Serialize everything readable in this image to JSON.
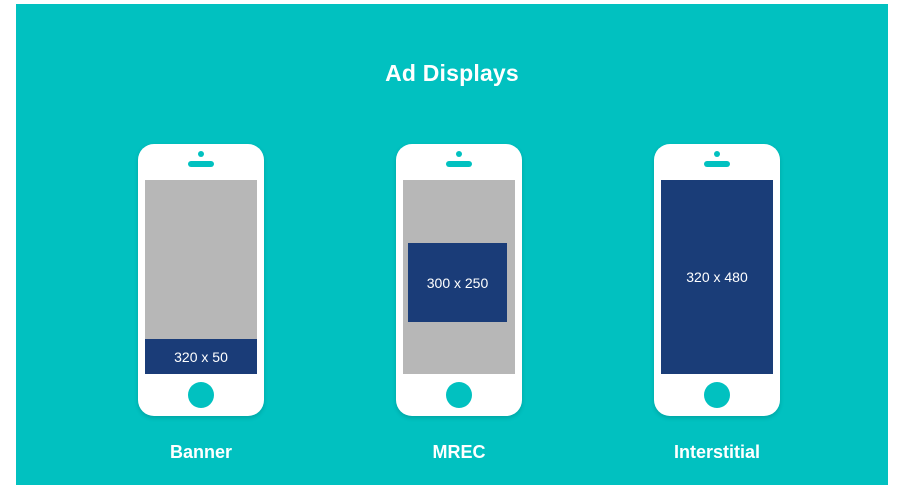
{
  "title": "Ad Displays",
  "phones": [
    {
      "label": "Banner",
      "ad_size": "320 x 50"
    },
    {
      "label": "MREC",
      "ad_size": "300 x 250"
    },
    {
      "label": "Interstitial",
      "ad_size": "320 x 480"
    }
  ],
  "colors": {
    "background": "#01c1c0",
    "ad_fill": "#1a3c78",
    "screen_gray": "#b7b7b7",
    "phone_body": "#ffffff"
  }
}
